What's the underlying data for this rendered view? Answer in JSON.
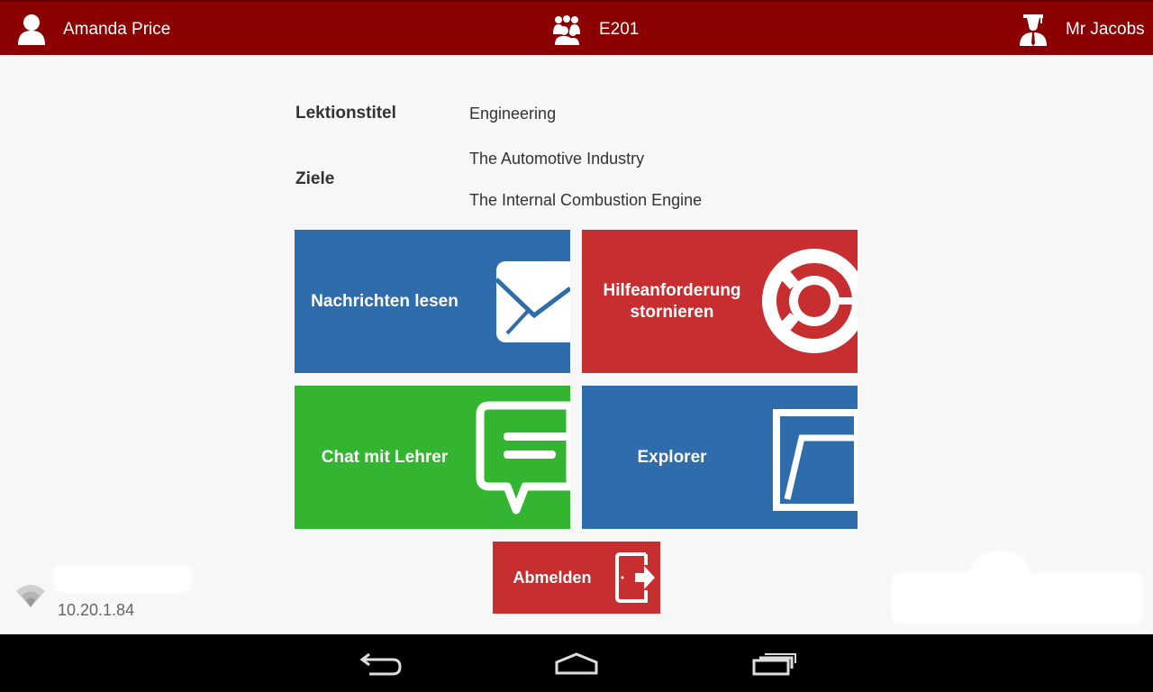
{
  "header": {
    "student_name": "Amanda Price",
    "room": "E201",
    "teacher_name": "Mr Jacobs",
    "background_color": "#8b0000"
  },
  "lesson": {
    "title_label": "Lektionstitel",
    "title_value": "Engineering",
    "goals_label": "Ziele",
    "goals": [
      "The Automotive Industry",
      "The Internal Combustion Engine"
    ]
  },
  "tiles": {
    "read_messages": {
      "label": "Nachrichten lesen",
      "icon": "envelope-icon",
      "color": "#2e6cab"
    },
    "cancel_help": {
      "label": "Hilfeanforderung stornieren",
      "icon": "lifebuoy-icon",
      "color": "#c62e30"
    },
    "chat_teacher": {
      "label": "Chat mit Lehrer",
      "icon": "chat-bubble-icon",
      "color": "#34b532"
    },
    "explorer": {
      "label": "Explorer",
      "icon": "folder-icon",
      "color": "#2e6cab"
    },
    "logout": {
      "label": "Abmelden",
      "icon": "exit-door-icon",
      "color": "#c62e30"
    }
  },
  "status": {
    "ip_address": "10.20.1.84",
    "wifi_icon": "wifi-icon"
  },
  "navbar": {
    "back_icon": "back-icon",
    "home_icon": "home-icon",
    "recent_icon": "recent-apps-icon"
  }
}
